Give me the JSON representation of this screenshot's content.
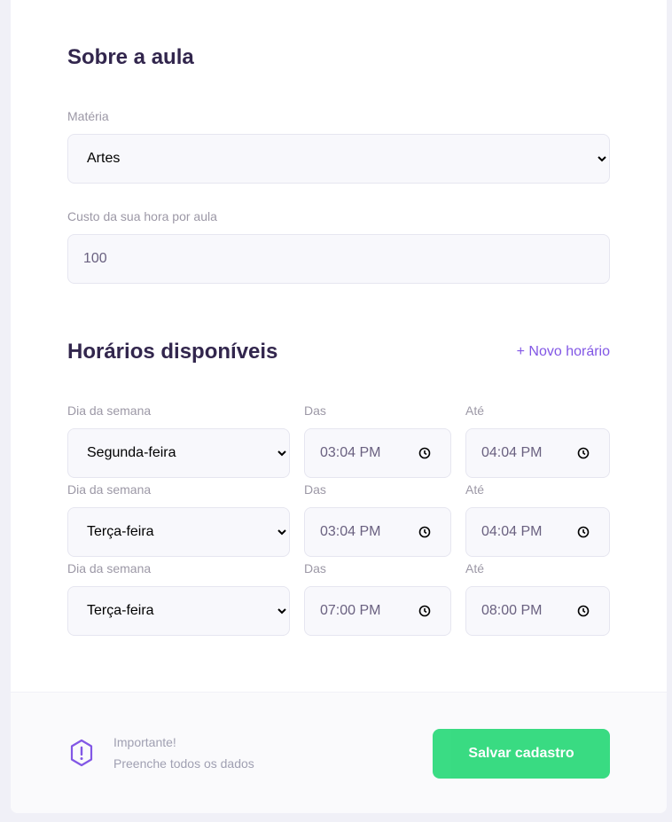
{
  "about": {
    "title": "Sobre a aula",
    "subject_label": "Matéria",
    "subject_value": "Artes",
    "cost_label": "Custo da sua hora por aula",
    "cost_value": "100"
  },
  "schedule": {
    "title": "Horários disponíveis",
    "add_label": "+ Novo horário",
    "rows": [
      {
        "day_label": "Dia da semana",
        "day_value": "Segunda-feira",
        "from_label": "Das",
        "from_value": "03:04 PM",
        "to_label": "Até",
        "to_value": "04:04 PM"
      },
      {
        "day_label": "Dia da semana",
        "day_value": "Terça-feira",
        "from_label": "Das",
        "from_value": "03:04 PM",
        "to_label": "Até",
        "to_value": "04:04 PM"
      },
      {
        "day_label": "Dia da semana",
        "day_value": "Terça-feira",
        "from_label": "Das",
        "from_value": "07:00 PM",
        "to_label": "Até",
        "to_value": "08:00 PM"
      }
    ]
  },
  "footer": {
    "warning_title": "Importante!",
    "warning_text": "Preenche todos os dados",
    "save_label": "Salvar cadastro"
  },
  "colors": {
    "title": "#32264D",
    "accent": "#8257E5",
    "save": "#04D361"
  }
}
